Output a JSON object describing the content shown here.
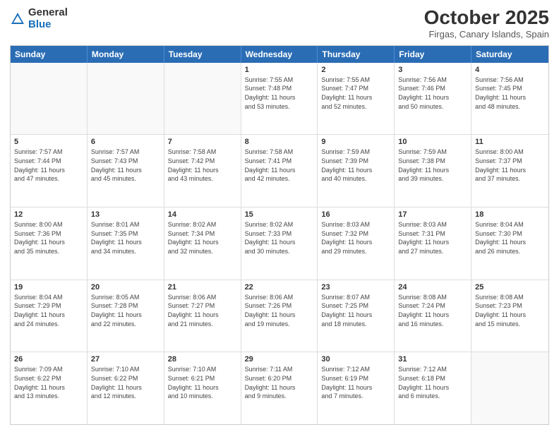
{
  "header": {
    "logo_general": "General",
    "logo_blue": "Blue",
    "month": "October 2025",
    "location": "Firgas, Canary Islands, Spain"
  },
  "days_of_week": [
    "Sunday",
    "Monday",
    "Tuesday",
    "Wednesday",
    "Thursday",
    "Friday",
    "Saturday"
  ],
  "weeks": [
    [
      {
        "day": "",
        "info": ""
      },
      {
        "day": "",
        "info": ""
      },
      {
        "day": "",
        "info": ""
      },
      {
        "day": "1",
        "info": "Sunrise: 7:55 AM\nSunset: 7:48 PM\nDaylight: 11 hours\nand 53 minutes."
      },
      {
        "day": "2",
        "info": "Sunrise: 7:55 AM\nSunset: 7:47 PM\nDaylight: 11 hours\nand 52 minutes."
      },
      {
        "day": "3",
        "info": "Sunrise: 7:56 AM\nSunset: 7:46 PM\nDaylight: 11 hours\nand 50 minutes."
      },
      {
        "day": "4",
        "info": "Sunrise: 7:56 AM\nSunset: 7:45 PM\nDaylight: 11 hours\nand 48 minutes."
      }
    ],
    [
      {
        "day": "5",
        "info": "Sunrise: 7:57 AM\nSunset: 7:44 PM\nDaylight: 11 hours\nand 47 minutes."
      },
      {
        "day": "6",
        "info": "Sunrise: 7:57 AM\nSunset: 7:43 PM\nDaylight: 11 hours\nand 45 minutes."
      },
      {
        "day": "7",
        "info": "Sunrise: 7:58 AM\nSunset: 7:42 PM\nDaylight: 11 hours\nand 43 minutes."
      },
      {
        "day": "8",
        "info": "Sunrise: 7:58 AM\nSunset: 7:41 PM\nDaylight: 11 hours\nand 42 minutes."
      },
      {
        "day": "9",
        "info": "Sunrise: 7:59 AM\nSunset: 7:39 PM\nDaylight: 11 hours\nand 40 minutes."
      },
      {
        "day": "10",
        "info": "Sunrise: 7:59 AM\nSunset: 7:38 PM\nDaylight: 11 hours\nand 39 minutes."
      },
      {
        "day": "11",
        "info": "Sunrise: 8:00 AM\nSunset: 7:37 PM\nDaylight: 11 hours\nand 37 minutes."
      }
    ],
    [
      {
        "day": "12",
        "info": "Sunrise: 8:00 AM\nSunset: 7:36 PM\nDaylight: 11 hours\nand 35 minutes."
      },
      {
        "day": "13",
        "info": "Sunrise: 8:01 AM\nSunset: 7:35 PM\nDaylight: 11 hours\nand 34 minutes."
      },
      {
        "day": "14",
        "info": "Sunrise: 8:02 AM\nSunset: 7:34 PM\nDaylight: 11 hours\nand 32 minutes."
      },
      {
        "day": "15",
        "info": "Sunrise: 8:02 AM\nSunset: 7:33 PM\nDaylight: 11 hours\nand 30 minutes."
      },
      {
        "day": "16",
        "info": "Sunrise: 8:03 AM\nSunset: 7:32 PM\nDaylight: 11 hours\nand 29 minutes."
      },
      {
        "day": "17",
        "info": "Sunrise: 8:03 AM\nSunset: 7:31 PM\nDaylight: 11 hours\nand 27 minutes."
      },
      {
        "day": "18",
        "info": "Sunrise: 8:04 AM\nSunset: 7:30 PM\nDaylight: 11 hours\nand 26 minutes."
      }
    ],
    [
      {
        "day": "19",
        "info": "Sunrise: 8:04 AM\nSunset: 7:29 PM\nDaylight: 11 hours\nand 24 minutes."
      },
      {
        "day": "20",
        "info": "Sunrise: 8:05 AM\nSunset: 7:28 PM\nDaylight: 11 hours\nand 22 minutes."
      },
      {
        "day": "21",
        "info": "Sunrise: 8:06 AM\nSunset: 7:27 PM\nDaylight: 11 hours\nand 21 minutes."
      },
      {
        "day": "22",
        "info": "Sunrise: 8:06 AM\nSunset: 7:26 PM\nDaylight: 11 hours\nand 19 minutes."
      },
      {
        "day": "23",
        "info": "Sunrise: 8:07 AM\nSunset: 7:25 PM\nDaylight: 11 hours\nand 18 minutes."
      },
      {
        "day": "24",
        "info": "Sunrise: 8:08 AM\nSunset: 7:24 PM\nDaylight: 11 hours\nand 16 minutes."
      },
      {
        "day": "25",
        "info": "Sunrise: 8:08 AM\nSunset: 7:23 PM\nDaylight: 11 hours\nand 15 minutes."
      }
    ],
    [
      {
        "day": "26",
        "info": "Sunrise: 7:09 AM\nSunset: 6:22 PM\nDaylight: 11 hours\nand 13 minutes."
      },
      {
        "day": "27",
        "info": "Sunrise: 7:10 AM\nSunset: 6:22 PM\nDaylight: 11 hours\nand 12 minutes."
      },
      {
        "day": "28",
        "info": "Sunrise: 7:10 AM\nSunset: 6:21 PM\nDaylight: 11 hours\nand 10 minutes."
      },
      {
        "day": "29",
        "info": "Sunrise: 7:11 AM\nSunset: 6:20 PM\nDaylight: 11 hours\nand 9 minutes."
      },
      {
        "day": "30",
        "info": "Sunrise: 7:12 AM\nSunset: 6:19 PM\nDaylight: 11 hours\nand 7 minutes."
      },
      {
        "day": "31",
        "info": "Sunrise: 7:12 AM\nSunset: 6:18 PM\nDaylight: 11 hours\nand 6 minutes."
      },
      {
        "day": "",
        "info": ""
      }
    ]
  ]
}
